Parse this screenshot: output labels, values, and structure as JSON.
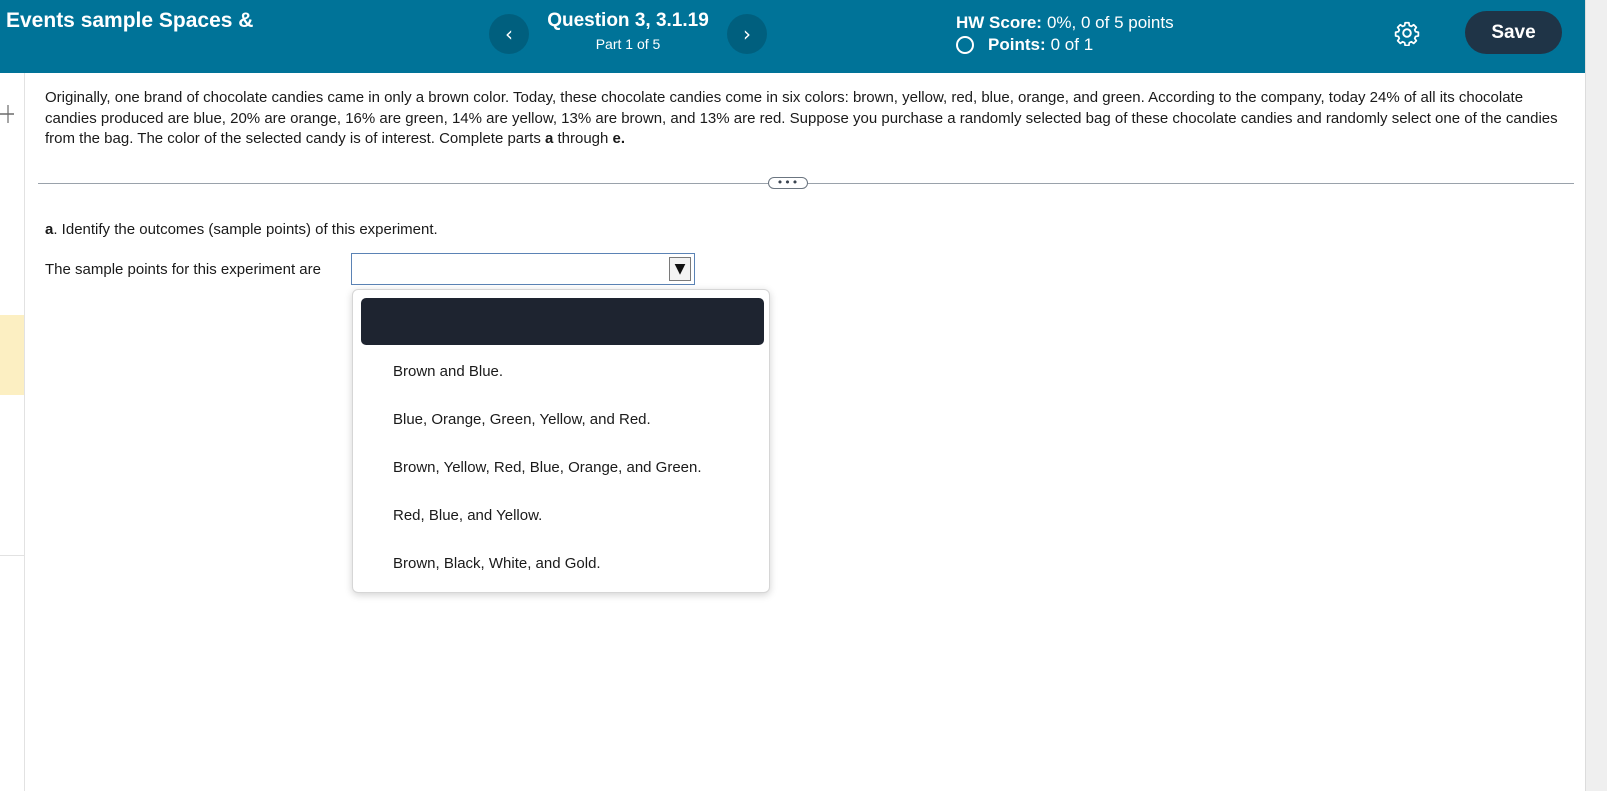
{
  "header": {
    "assignment_title": "Events sample Spaces &",
    "question_title": "Question 3, 3.1.19",
    "question_part": "Part 1 of 5",
    "prev_symbol": "‹",
    "next_symbol": "›",
    "hw_score_label": "HW Score:",
    "hw_score_value": "0%, 0 of 5 points",
    "points_label": "Points:",
    "points_value": "0 of 1",
    "settings_icon": "gear-icon",
    "save_label": "Save",
    "background_color": "#007398",
    "save_button_color": "#1f3447"
  },
  "question": {
    "text_part1": "Originally, one brand of chocolate candies came in only a brown color. Today, these chocolate candies come in six colors: brown, yellow, red, blue, orange, and green. According to the company, today 24% of all its chocolate candies produced are blue, 20% are orange, 16% are green, 14% are yellow, 13% are brown, and 13% are red. Suppose you purchase a randomly selected bag of these chocolate candies and randomly select one of the candies from the bag. The color of the selected candy is of interest. Complete parts ",
    "bold_a": "a",
    "text_through": " through ",
    "bold_e": "e.",
    "expand_label": "•••"
  },
  "part_a": {
    "letter": "a",
    "prompt": ". Identify the outcomes (sample points) of this experiment.",
    "answer_label": "The sample points for this experiment are",
    "selected_value": "",
    "arrow_symbol": "▼"
  },
  "dropdown": {
    "options": [
      "Brown and Blue.",
      "Blue, Orange, Green, Yellow, and Red.",
      "Brown, Yellow, Red, Blue, Orange, and Green.",
      "Red, Blue, and Yellow.",
      "Brown, Black, White, and Gold."
    ],
    "highlight_color": "#1e2430"
  }
}
